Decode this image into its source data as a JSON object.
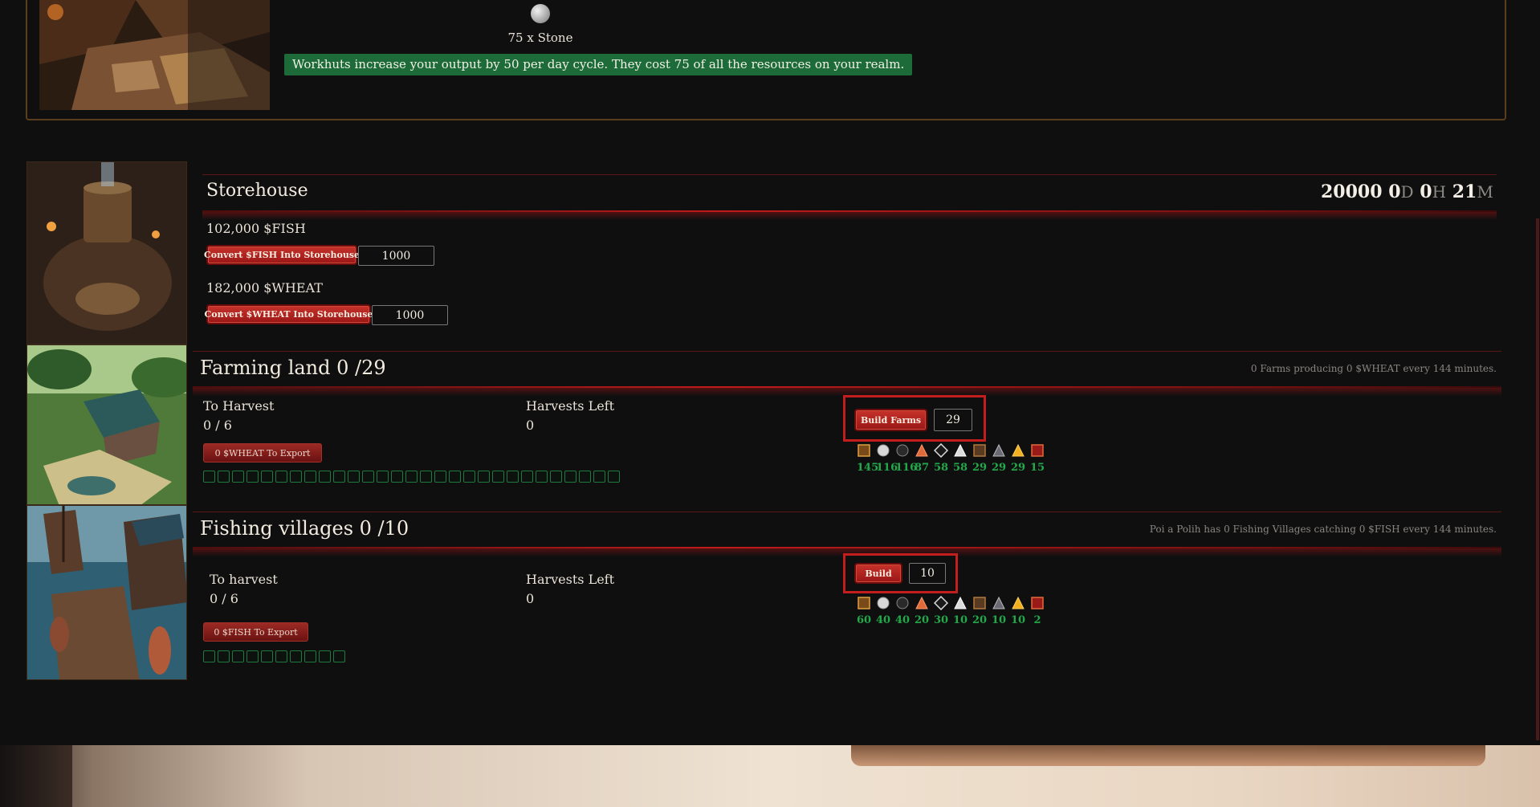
{
  "workhut": {
    "cost_label": "75 x Stone",
    "note": "Workhuts increase your output by 50 per day cycle. They cost 75 of all the resources on your realm."
  },
  "storehouse": {
    "title": "Storehouse",
    "timer": {
      "value": "20000",
      "d": "0",
      "d_unit": "D",
      "h": "0",
      "h_unit": "H",
      "m": "21",
      "m_unit": "M"
    },
    "fish_amount": "102,000 $FISH",
    "fish_button": "Convert $FISH Into Storehouse",
    "fish_input": "1000",
    "wheat_amount": "182,000 $WHEAT",
    "wheat_button": "Convert $WHEAT Into Storehouse",
    "wheat_input": "1000"
  },
  "farming": {
    "title": "Farming land 0 /29",
    "status": "0 Farms producing 0 $WHEAT every 144 minutes.",
    "to_harvest_label": "To Harvest",
    "to_harvest_value": "0 / 6",
    "harvests_left_label": "Harvests Left",
    "harvests_left_value": "0",
    "export_button": "0 $WHEAT To Export",
    "build_button": "Build Farms",
    "build_input": "29",
    "slot_count": 29,
    "costs": [
      {
        "icon": "wood-icon",
        "value": "145"
      },
      {
        "icon": "stone-icon",
        "value": "116"
      },
      {
        "icon": "coal-icon",
        "value": "116"
      },
      {
        "icon": "copper-icon",
        "value": "87"
      },
      {
        "icon": "obsidian-icon",
        "value": "58"
      },
      {
        "icon": "silver-icon",
        "value": "58"
      },
      {
        "icon": "ironwood-icon",
        "value": "29"
      },
      {
        "icon": "cold-iron-icon",
        "value": "29"
      },
      {
        "icon": "gold-icon",
        "value": "29"
      },
      {
        "icon": "hartwood-icon",
        "value": "15"
      }
    ]
  },
  "fishing": {
    "title": "Fishing villages 0 /10",
    "status": "Poi a Polih has 0 Fishing Villages catching 0 $FISH every 144 minutes.",
    "to_harvest_label": "To harvest",
    "to_harvest_value": "0 / 6",
    "harvests_left_label": "Harvests Left",
    "harvests_left_value": "0",
    "export_button": "0 $FISH To Export",
    "build_button": "Build",
    "build_input": "10",
    "slot_count": 10,
    "costs": [
      {
        "icon": "wood-icon",
        "value": "60"
      },
      {
        "icon": "stone-icon",
        "value": "40"
      },
      {
        "icon": "coal-icon",
        "value": "40"
      },
      {
        "icon": "copper-icon",
        "value": "20"
      },
      {
        "icon": "obsidian-icon",
        "value": "30"
      },
      {
        "icon": "silver-icon",
        "value": "10"
      },
      {
        "icon": "ironwood-icon",
        "value": "20"
      },
      {
        "icon": "cold-iron-icon",
        "value": "10"
      },
      {
        "icon": "gold-icon",
        "value": "10"
      },
      {
        "icon": "hartwood-icon",
        "value": "2"
      }
    ]
  }
}
